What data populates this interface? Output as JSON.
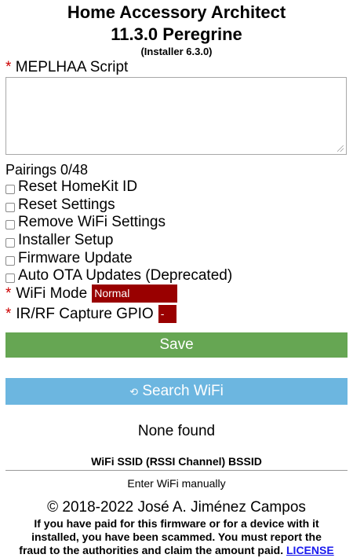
{
  "header": {
    "title_line1": "Home Accessory Architect",
    "title_line2": "11.3.0 Peregrine",
    "installer_version": "(Installer 6.3.0)"
  },
  "script": {
    "required_mark": "*",
    "label": "MEPLHAA Script",
    "value": ""
  },
  "pairings": "Pairings 0/48",
  "options": [
    {
      "label": "Reset HomeKit ID",
      "checked": false
    },
    {
      "label": "Reset Settings",
      "checked": false
    },
    {
      "label": "Remove WiFi Settings",
      "checked": false
    },
    {
      "label": "Installer Setup",
      "checked": false
    },
    {
      "label": "Firmware Update",
      "checked": false
    },
    {
      "label": "Auto OTA Updates (Deprecated)",
      "checked": false
    }
  ],
  "wifi_mode": {
    "required_mark": "*",
    "label": "WiFi Mode",
    "selected": "Normal"
  },
  "irrf_gpio": {
    "required_mark": "*",
    "label": "IR/RF Capture GPIO",
    "selected": "-"
  },
  "buttons": {
    "save": "Save",
    "search_wifi_icon": "⟲",
    "search_wifi": "Search WiFi"
  },
  "wifi": {
    "status": "None found",
    "table_header": "WiFi SSID (RSSI Channel) BSSID",
    "manual": "Enter WiFi manually"
  },
  "footer": {
    "copyright": "© 2018-2022 José A. Jiménez Campos",
    "warning_line1": "If you have paid for this firmware or for a device with it",
    "warning_line2": "installed, you have been scammed. You must report the",
    "warning_line3": "fraud to the authorities and claim the amount paid.",
    "license_link": "LICENSE"
  },
  "colors": {
    "required": "#cc0000",
    "select_bg": "#990000",
    "save_bg": "#66a653",
    "search_bg": "#6cb6e0",
    "link": "#1a1aee"
  }
}
